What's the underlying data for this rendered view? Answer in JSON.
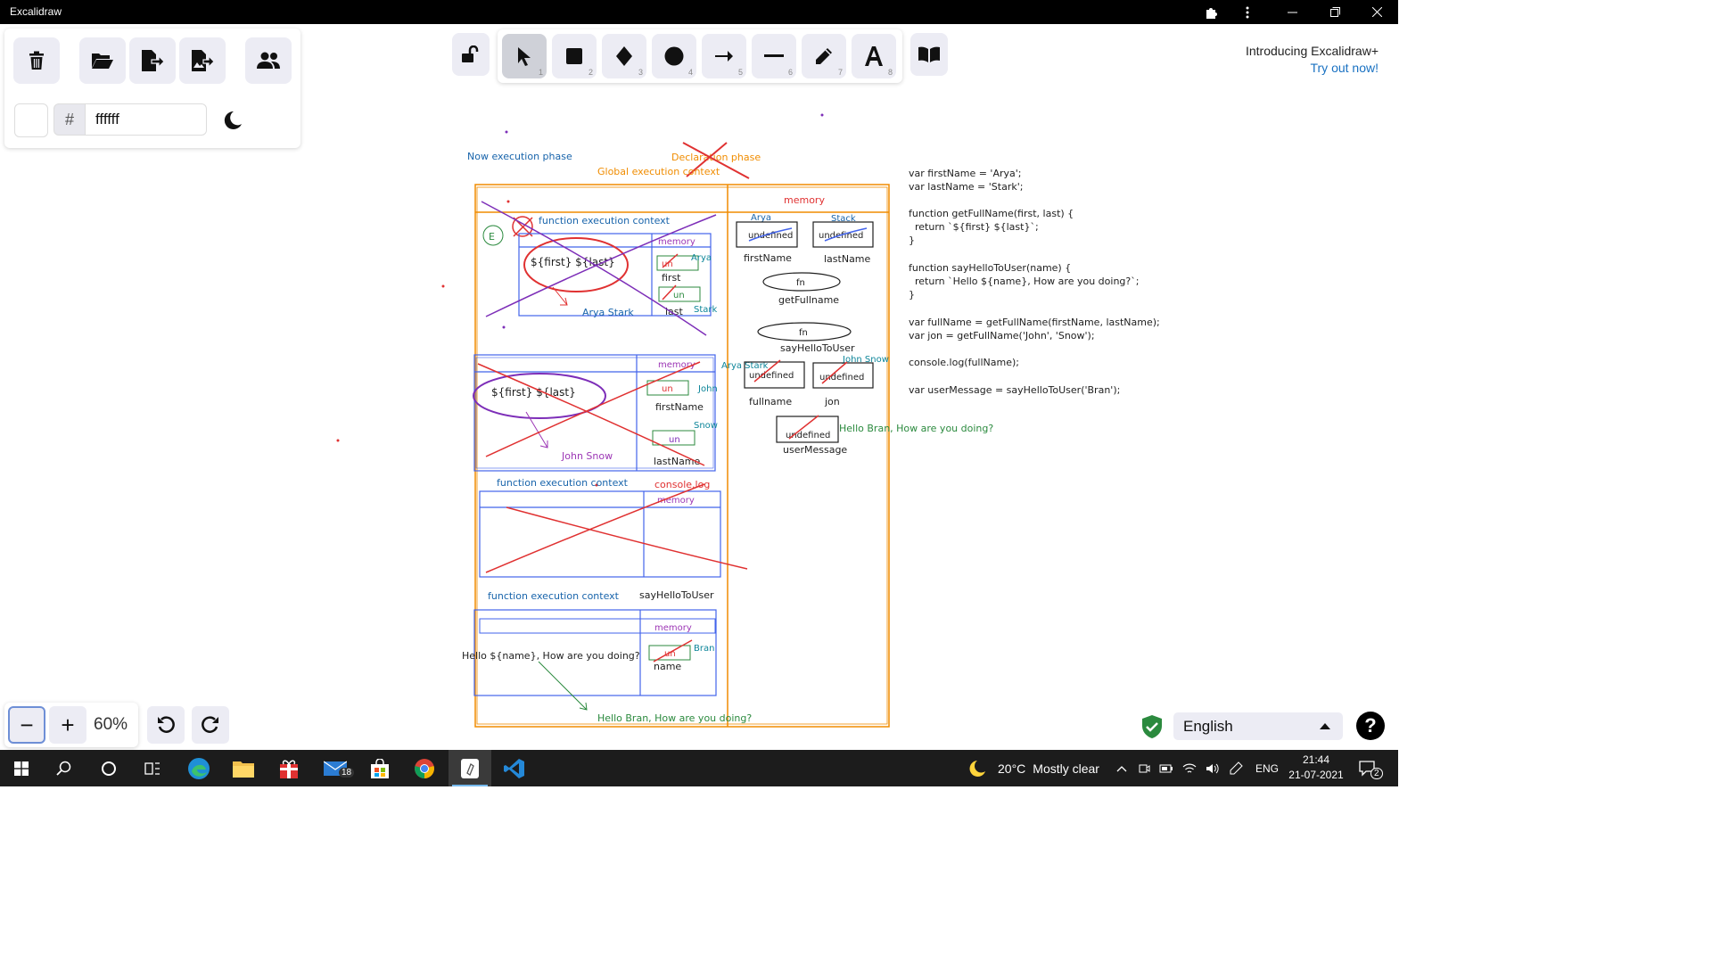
{
  "window": {
    "title": "Excalidraw"
  },
  "colors": {
    "blue": "#1864ab",
    "orange": "#f08c00",
    "red": "#e03131",
    "purple": "#7d2eb8",
    "green": "#2b8a3e",
    "teal": "#0c8599",
    "violet": "#9c36b5",
    "black": "#1e1e1e"
  },
  "main_menu": {
    "buttons": [
      {
        "name": "clear-canvas",
        "icon": "trash-icon"
      },
      {
        "name": "open",
        "icon": "folder-open-icon"
      },
      {
        "name": "save",
        "icon": "file-export-icon"
      },
      {
        "name": "export-image",
        "icon": "image-export-icon"
      },
      {
        "name": "live-collaboration",
        "icon": "users-icon"
      }
    ],
    "background_hash": "#",
    "background_value": "ffffff",
    "theme_icon": "moon-icon"
  },
  "toolbar": {
    "tools": [
      {
        "name": "selection",
        "icon": "pointer-icon",
        "key": "1",
        "active": true
      },
      {
        "name": "rectangle",
        "icon": "square-icon",
        "key": "2"
      },
      {
        "name": "diamond",
        "icon": "diamond-icon",
        "key": "3"
      },
      {
        "name": "ellipse",
        "icon": "circle-icon",
        "key": "4"
      },
      {
        "name": "arrow",
        "icon": "arrow-right-icon",
        "key": "5"
      },
      {
        "name": "line",
        "icon": "line-icon",
        "key": "6"
      },
      {
        "name": "draw",
        "icon": "pencil-icon",
        "key": "7"
      },
      {
        "name": "text",
        "icon": "text-icon",
        "key": "8"
      }
    ]
  },
  "promo": {
    "line1": "Introducing Excalidraw+",
    "line2": "Try out now!"
  },
  "zoom": {
    "minus": "−",
    "plus": "+",
    "level": "60%"
  },
  "language": {
    "selected": "English"
  },
  "help": {
    "label": "?"
  },
  "drawing": {
    "top_left": "Now execution phase",
    "top_strike": "Declaration phase",
    "global_context": "Global execution context",
    "memory_headers": [
      "memory",
      "memory",
      "memory",
      "memory",
      "memory"
    ],
    "fec1": {
      "label": "function execution context",
      "template": "${first} ${last}",
      "result": "Arya Stark",
      "badge": "E"
    },
    "var_labels": [
      "first",
      "last",
      "firstName",
      "lastName",
      "name"
    ],
    "un_labels": [
      "un",
      "un",
      "un",
      "un",
      "un"
    ],
    "fec2": {
      "template": "${first} ${last}",
      "result": "John Snow"
    },
    "fec3": {
      "label": "function execution context",
      "callee": "console.log"
    },
    "fec4": {
      "label": "function execution context",
      "callee": "sayHelloToUser",
      "template": "Hello ${name}, How are you doing?",
      "result": "Hello Bran, How are you doing?"
    },
    "global_memory": {
      "vars": [
        {
          "label": "firstName",
          "value": "undefined",
          "new_value": "Arya"
        },
        {
          "label": "lastName",
          "value": "undefined",
          "new_value": "Stack"
        },
        {
          "label": "getFullname",
          "value": "fn"
        },
        {
          "label": "sayHelloToUser",
          "value": "fn"
        },
        {
          "label": "fullname",
          "value": "undefined",
          "new_value": "Arya Stark"
        },
        {
          "label": "jon",
          "value": "undefined",
          "new_value": "John Snow"
        },
        {
          "label": "userMessage",
          "value": "undefined",
          "new_value": "Hello Bran, How are you doing?"
        }
      ]
    },
    "side_values": {
      "arya": "Arya",
      "stark": "Stark",
      "john": "John",
      "snow": "Snow",
      "bran": "Bran"
    },
    "code": [
      "var firstName = 'Arya';",
      "var lastName = 'Stark';",
      "",
      "function getFullName(first, last) {",
      "  return `${first} ${last}`;",
      "}",
      "",
      "function sayHelloToUser(name) {",
      "  return `Hello ${name}, How are you doing?`;",
      "}",
      "",
      "var fullName = getFullName(firstName, lastName);",
      "var jon = getFullName('John', 'Snow');",
      "",
      "console.log(fullName);",
      "",
      "var userMessage = sayHelloToUser('Bran');"
    ]
  },
  "taskbar": {
    "items": [
      {
        "name": "start",
        "icon": "windows-icon"
      },
      {
        "name": "search",
        "icon": "search-icon"
      },
      {
        "name": "cortana",
        "icon": "circle-icon"
      },
      {
        "name": "task-view",
        "icon": "task-view-icon"
      },
      {
        "name": "edge",
        "icon": "edge-icon"
      },
      {
        "name": "file-explorer",
        "icon": "folder-icon"
      },
      {
        "name": "gift-app",
        "icon": "gift-icon"
      },
      {
        "name": "mail",
        "icon": "mail-icon",
        "badge": "18"
      },
      {
        "name": "store",
        "icon": "store-icon"
      },
      {
        "name": "chrome",
        "icon": "chrome-icon"
      },
      {
        "name": "excalidraw",
        "icon": "excalidraw-icon",
        "active": true
      },
      {
        "name": "vscode",
        "icon": "vscode-icon"
      }
    ],
    "weather": {
      "temp": "20°C",
      "condition": "Mostly clear"
    },
    "tray_lang": "ENG",
    "clock": {
      "time": "21:44",
      "date": "21-07-2021"
    },
    "notification_count": "2"
  }
}
